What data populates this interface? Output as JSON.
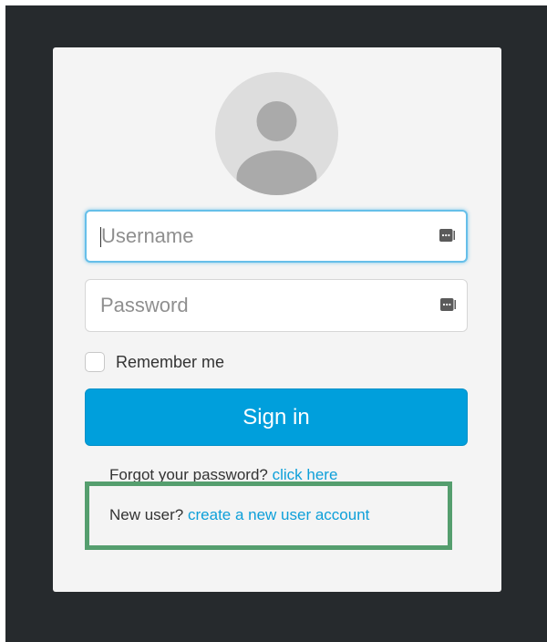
{
  "login": {
    "avatar_icon": "user-avatar-icon",
    "username": {
      "value": "",
      "placeholder": "Username",
      "icon": "password-manager-key-icon"
    },
    "password": {
      "value": "",
      "placeholder": "Password",
      "icon": "password-manager-key-icon"
    },
    "remember_me": {
      "label": "Remember me",
      "checked": false
    },
    "sign_in_label": "Sign in",
    "forgot": {
      "text": "Forgot your password?",
      "link": "click here"
    },
    "new_user": {
      "text": "New user?",
      "link": "create a new user account"
    }
  },
  "colors": {
    "backdrop": "#262a2d",
    "card": "#f4f4f4",
    "primary_button": "#009fdc",
    "link": "#0d9fd9",
    "focus_border": "#66bfe9",
    "highlight_box": "#559e6e"
  }
}
